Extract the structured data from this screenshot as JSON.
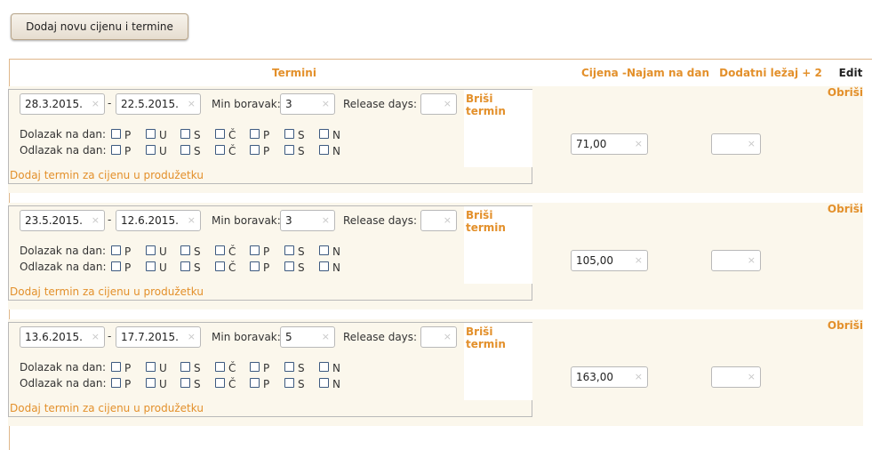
{
  "add_button_label": "Dodaj novu cijenu i termine",
  "headers": {
    "termini": "Termini",
    "cijena": "Cijena -Najam na dan",
    "dodatni": "Dodatni ležaj + 2",
    "edit": "Edit"
  },
  "labels": {
    "min_boravak": "Min boravak:",
    "release_days": "Release days:",
    "dolazak": "Dolazak na dan:",
    "odlazak": "Odlazak na dan:",
    "brisi_termin": "Briši termin",
    "dodaj_termin": "Dodaj termin za cijenu u produžetku",
    "obrisi": "Obriši",
    "dash": "-",
    "clear": "×"
  },
  "days": [
    "P",
    "U",
    "S",
    "Č",
    "P",
    "S",
    "N"
  ],
  "rows": [
    {
      "date_from": "28.3.2015.",
      "date_to": "22.5.2015.",
      "min_boravak": "3",
      "release_days": "",
      "price": "71,00",
      "extra_bed": ""
    },
    {
      "date_from": "23.5.2015.",
      "date_to": "12.6.2015.",
      "min_boravak": "3",
      "release_days": "",
      "price": "105,00",
      "extra_bed": ""
    },
    {
      "date_from": "13.6.2015.",
      "date_to": "17.7.2015.",
      "min_boravak": "5",
      "release_days": "",
      "price": "163,00",
      "extra_bed": ""
    }
  ]
}
